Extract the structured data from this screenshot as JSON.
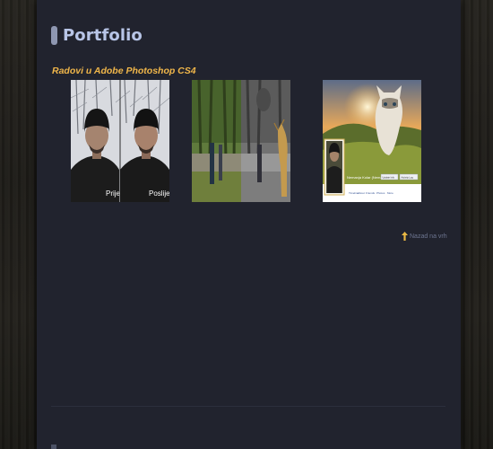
{
  "page": {
    "title": "Portfolio",
    "section_title": "Radovi u Adobe Photoshop CS4",
    "back_to_top": "Nazad na vrh"
  },
  "thumbnails": [
    {
      "name": "before-after-portrait",
      "labels": [
        "Prije",
        "Poslije"
      ]
    },
    {
      "name": "park-photo-manipulation",
      "labels": []
    },
    {
      "name": "facebook-cover-edit",
      "profile_name": "Nemanja Kolar (Nema)",
      "tabs": [
        "Timeline",
        "About",
        "Friends",
        "Photos",
        "More"
      ],
      "buttons": [
        "Update Info",
        "Activity Log"
      ]
    }
  ],
  "colors": {
    "content_bg": "#21232e",
    "title": "#b8c5e7",
    "section_title": "#f0b64a",
    "back_to_top": "#6d7590",
    "arrow": "#e9b844"
  },
  "icons": {
    "back_to_top": "up-arrow-icon"
  }
}
